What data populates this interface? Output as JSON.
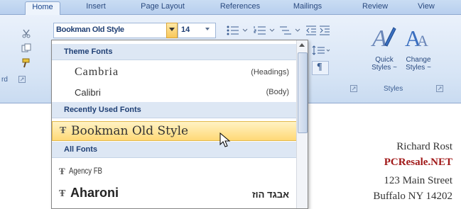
{
  "ribbon_tabs": [
    {
      "label": "Home"
    },
    {
      "label": "Insert"
    },
    {
      "label": "Page Layout"
    },
    {
      "label": "References"
    },
    {
      "label": "Mailings"
    },
    {
      "label": "Review"
    },
    {
      "label": "View"
    }
  ],
  "font": {
    "current_font": "Bookman Old Style",
    "current_size": "14"
  },
  "clipboard_group": {
    "label": "rd"
  },
  "styles_group": {
    "quick_styles_line1": "Quick",
    "quick_styles_line2": "Styles ~",
    "change_styles_line1": "Change",
    "change_styles_line2": "Styles ~",
    "label": "Styles"
  },
  "dropdown": {
    "theme_fonts_header": "Theme Fonts",
    "theme_fonts": [
      {
        "name": "Cambria",
        "tag": "(Headings)"
      },
      {
        "name": "Calibri",
        "tag": "(Body)"
      }
    ],
    "recent_header": "Recently Used Fonts",
    "recent_fonts": [
      {
        "name": "Bookman Old Style"
      }
    ],
    "all_fonts_header": "All Fonts",
    "all_fonts": [
      {
        "name": "Agency FB",
        "tag": ""
      },
      {
        "name": "Aharoni",
        "tag": "אבגד הוז"
      }
    ]
  },
  "document": {
    "address_lines": [
      "Richard Rost",
      "PCResale.NET",
      "123 Main Street",
      "Buffalo NY 14202"
    ]
  },
  "colors": {
    "accent": "#15428b",
    "highlight": "#ffd976",
    "company_red": "#a01818"
  }
}
